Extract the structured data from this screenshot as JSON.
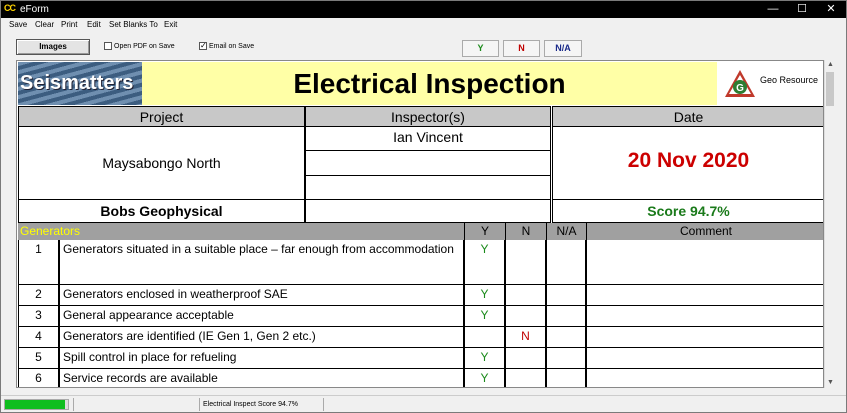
{
  "window": {
    "app_icon_text": "CC",
    "title": "eForm",
    "buttons": {
      "minimize": "—",
      "maximize": "☐",
      "close": "✕"
    }
  },
  "menu": [
    "Save",
    "Clear",
    "Print",
    "Edit",
    "Set Blanks To",
    "Exit"
  ],
  "toolbar": {
    "images_label": "Images",
    "open_pdf_label": "Open PDF on Save",
    "open_pdf_checked": false,
    "email_label": "Email on Save",
    "email_checked": true,
    "y_label": "Y",
    "n_label": "N",
    "na_label": "N/A"
  },
  "form": {
    "logo_left_text": "Seismatters",
    "title": "Electrical Inspection",
    "logo_right_text": "Geo Resource",
    "logo_right_emblem_letter": "G",
    "headers": {
      "project": "Project",
      "inspectors": "Inspector(s)",
      "date": "Date"
    },
    "project": "Maysabongo North",
    "inspectors": [
      "Ian Vincent",
      "",
      ""
    ],
    "date": "20 Nov 2020",
    "company": "Bobs Geophysical",
    "score": "Score 94.7%",
    "section": {
      "name": "Generators",
      "col_y": "Y",
      "col_n": "N",
      "col_na": "N/A",
      "col_comment": "Comment"
    },
    "items": [
      {
        "num": "1",
        "text": "Generators situated in a suitable place – far enough from accommodation",
        "y": "Y",
        "n": "",
        "na": "",
        "comment": ""
      },
      {
        "num": "2",
        "text": "Generators enclosed in weatherproof SAE",
        "y": "Y",
        "n": "",
        "na": "",
        "comment": ""
      },
      {
        "num": "3",
        "text": "General appearance acceptable",
        "y": "Y",
        "n": "",
        "na": "",
        "comment": ""
      },
      {
        "num": "4",
        "text": "Generators are identified (IE Gen 1, Gen 2 etc.)",
        "y": "",
        "n": "N",
        "na": "",
        "comment": ""
      },
      {
        "num": "5",
        "text": "Spill control in place for refueling",
        "y": "Y",
        "n": "",
        "na": "",
        "comment": ""
      },
      {
        "num": "6",
        "text": "Service records are available",
        "y": "Y",
        "n": "",
        "na": "",
        "comment": ""
      }
    ]
  },
  "status": {
    "progress_fraction": 0.947,
    "text": "Electrical Inspect  Score 94.7%"
  },
  "colors": {
    "title_bg": "#ffffa6",
    "header_gray": "#c8c8c8",
    "section_gray": "#a0a0a0",
    "section_text": "#ffff00",
    "date_red": "#cc0000",
    "score_green": "#1a7a1a",
    "progress_green": "#0fbe1f"
  }
}
